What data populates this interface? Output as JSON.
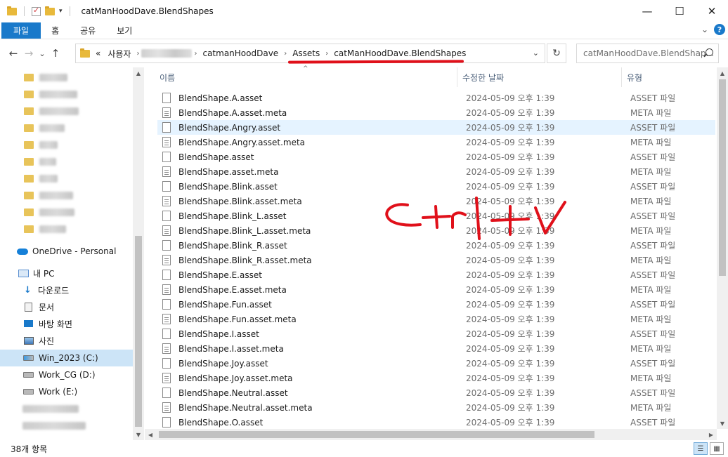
{
  "window": {
    "title": "catManHoodDave.BlendShapes",
    "controls": {
      "minimize": "—",
      "maximize": "☐",
      "close": "✕"
    }
  },
  "ribbon": {
    "tabs": [
      "파일",
      "홈",
      "공유",
      "보기"
    ]
  },
  "nav": {
    "back": "←",
    "forward": "→",
    "recent": "⌄",
    "up": "↑",
    "refresh": "↻",
    "breadcrumb": {
      "overflow": "«",
      "items": [
        "사용자",
        "catmanHoodDave",
        "Assets",
        "catManHoodDave.BlendShapes"
      ],
      "separator": "›"
    },
    "search_placeholder": "catManHoodDave.BlendShap..."
  },
  "sidebar": {
    "onedrive": "OneDrive - Personal",
    "pc": "내 PC",
    "pc_items": [
      "다운로드",
      "문서",
      "바탕 화면",
      "사진",
      "Win_2023 (C:)",
      "Work_CG (D:)",
      "Work (E:)"
    ]
  },
  "columns": {
    "name": "이름",
    "date": "수정한 날짜",
    "type": "유형"
  },
  "files": [
    {
      "name": "BlendShape.A.asset",
      "date": "2024-05-09 오후 1:39",
      "type": "ASSET 파일",
      "icon": "file-icon"
    },
    {
      "name": "BlendShape.A.asset.meta",
      "date": "2024-05-09 오후 1:39",
      "type": "META 파일",
      "icon": "meta-file-icon"
    },
    {
      "name": "BlendShape.Angry.asset",
      "date": "2024-05-09 오후 1:39",
      "type": "ASSET 파일",
      "icon": "file-icon"
    },
    {
      "name": "BlendShape.Angry.asset.meta",
      "date": "2024-05-09 오후 1:39",
      "type": "META 파일",
      "icon": "meta-file-icon"
    },
    {
      "name": "BlendShape.asset",
      "date": "2024-05-09 오후 1:39",
      "type": "ASSET 파일",
      "icon": "file-icon"
    },
    {
      "name": "BlendShape.asset.meta",
      "date": "2024-05-09 오후 1:39",
      "type": "META 파일",
      "icon": "meta-file-icon"
    },
    {
      "name": "BlendShape.Blink.asset",
      "date": "2024-05-09 오후 1:39",
      "type": "ASSET 파일",
      "icon": "file-icon"
    },
    {
      "name": "BlendShape.Blink.asset.meta",
      "date": "2024-05-09 오후 1:39",
      "type": "META 파일",
      "icon": "meta-file-icon"
    },
    {
      "name": "BlendShape.Blink_L.asset",
      "date": "2024-05-09 오후 1:39",
      "type": "ASSET 파일",
      "icon": "file-icon"
    },
    {
      "name": "BlendShape.Blink_L.asset.meta",
      "date": "2024-05-09 오후 1:39",
      "type": "META 파일",
      "icon": "meta-file-icon"
    },
    {
      "name": "BlendShape.Blink_R.asset",
      "date": "2024-05-09 오후 1:39",
      "type": "ASSET 파일",
      "icon": "file-icon"
    },
    {
      "name": "BlendShape.Blink_R.asset.meta",
      "date": "2024-05-09 오후 1:39",
      "type": "META 파일",
      "icon": "meta-file-icon"
    },
    {
      "name": "BlendShape.E.asset",
      "date": "2024-05-09 오후 1:39",
      "type": "ASSET 파일",
      "icon": "file-icon"
    },
    {
      "name": "BlendShape.E.asset.meta",
      "date": "2024-05-09 오후 1:39",
      "type": "META 파일",
      "icon": "meta-file-icon"
    },
    {
      "name": "BlendShape.Fun.asset",
      "date": "2024-05-09 오후 1:39",
      "type": "ASSET 파일",
      "icon": "file-icon"
    },
    {
      "name": "BlendShape.Fun.asset.meta",
      "date": "2024-05-09 오후 1:39",
      "type": "META 파일",
      "icon": "meta-file-icon"
    },
    {
      "name": "BlendShape.I.asset",
      "date": "2024-05-09 오후 1:39",
      "type": "ASSET 파일",
      "icon": "file-icon"
    },
    {
      "name": "BlendShape.I.asset.meta",
      "date": "2024-05-09 오후 1:39",
      "type": "META 파일",
      "icon": "meta-file-icon"
    },
    {
      "name": "BlendShape.Joy.asset",
      "date": "2024-05-09 오후 1:39",
      "type": "ASSET 파일",
      "icon": "file-icon"
    },
    {
      "name": "BlendShape.Joy.asset.meta",
      "date": "2024-05-09 오후 1:39",
      "type": "META 파일",
      "icon": "meta-file-icon"
    },
    {
      "name": "BlendShape.Neutral.asset",
      "date": "2024-05-09 오후 1:39",
      "type": "ASSET 파일",
      "icon": "file-icon"
    },
    {
      "name": "BlendShape.Neutral.asset.meta",
      "date": "2024-05-09 오후 1:39",
      "type": "META 파일",
      "icon": "meta-file-icon"
    },
    {
      "name": "BlendShape.O.asset",
      "date": "2024-05-09 오후 1:39",
      "type": "ASSET 파일",
      "icon": "file-icon"
    }
  ],
  "hovered_row": 2,
  "annotation": {
    "text": "Ctrl+V",
    "color": "#e0101a"
  },
  "status": {
    "item_count": "38개 항목"
  },
  "colors": {
    "accent": "#1979ca",
    "selection": "#cce4f7",
    "hover": "#e5f3ff",
    "annotation": "#e0101a"
  }
}
